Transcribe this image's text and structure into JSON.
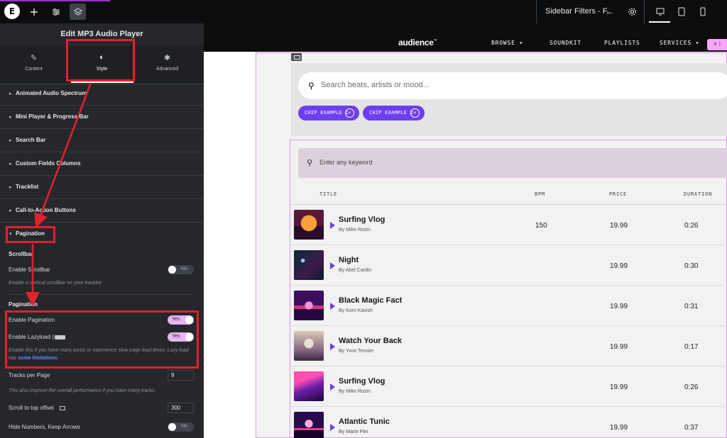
{
  "topbar": {
    "doc_title": "Sidebar Filters - F...",
    "icons": [
      "elementor-logo-icon",
      "plus-icon",
      "sliders-icon",
      "layers-icon",
      "settings-icon",
      "desktop-icon",
      "tablet-icon",
      "mobile-icon"
    ]
  },
  "panel": {
    "title": "Edit MP3 Audio Player",
    "tabs": [
      {
        "label": "Content",
        "icon": "pencil-icon"
      },
      {
        "label": "Style",
        "icon": "contrast-icon"
      },
      {
        "label": "Advanced",
        "icon": "gear-icon"
      }
    ],
    "sections": [
      {
        "label": "Animated Audio Spectrum"
      },
      {
        "label": "Mini Player & Progress Bar"
      },
      {
        "label": "Search Bar"
      },
      {
        "label": "Custom Fields Columns"
      },
      {
        "label": "Tracklist"
      },
      {
        "label": "Call-to-Action Buttons"
      }
    ],
    "open_section": "Pagination",
    "scrollbar": {
      "heading": "Scrollbar",
      "enable_label": "Enable Scrollbar",
      "enable_value": "No",
      "description": "Enable a vertical scrollbar on your tracklist"
    },
    "pagination": {
      "heading": "Pagination",
      "enable_label": "Enable Pagination",
      "enable_value": "Yes",
      "lazy_label": "Enable Lazyload (",
      "lazy_value": "Yes",
      "lazy_description": "Enable this if you have many posts or experience slow page load times. Lazy load has ",
      "lazy_link": "some limitations."
    },
    "tracks_per_page": {
      "label": "Tracks per Page",
      "value": "9",
      "description": "This also improve the overall performance if you have many tracks."
    },
    "scroll_offset": {
      "label": "Scroll to top offset",
      "value": "300"
    },
    "hide_numbers": {
      "label": "Hide Numbers, Keep Arrows",
      "value": "No"
    }
  },
  "site": {
    "logo": "audience",
    "logo_tm": "™",
    "nav": [
      "BROWSE",
      "SOUNDKIT",
      "PLAYLISTS",
      "SERVICES"
    ],
    "search_placeholder": "Search beats, artists or mood...",
    "chips": [
      "CHIP EXAMPLE 1",
      "CHIP EXAMPLE 2"
    ],
    "keyword_placeholder": "Enter any keyword",
    "columns": [
      "TITLE",
      "BPM",
      "PRICE",
      "DURATION"
    ],
    "tracks": [
      {
        "title": "Surfing Vlog",
        "artist": "By Mike Rozin",
        "bpm": "150",
        "price": "19.99",
        "duration": "0:26"
      },
      {
        "title": "Night",
        "artist": "By Abel Cardin",
        "bpm": "",
        "price": "19.99",
        "duration": "0:30"
      },
      {
        "title": "Black Magic Fact",
        "artist": "By Koro Kavish",
        "bpm": "",
        "price": "19.99",
        "duration": "0:31"
      },
      {
        "title": "Watch Your Back",
        "artist": "By Yvon Tessier",
        "bpm": "",
        "price": "19.99",
        "duration": "0:17"
      },
      {
        "title": "Surfing Vlog",
        "artist": "By Mike Rozin",
        "bpm": "",
        "price": "19.99",
        "duration": "0:26"
      },
      {
        "title": "Atlantic Tunic",
        "artist": "By Marie Pier",
        "bpm": "",
        "price": "19.99",
        "duration": "0:37"
      }
    ]
  },
  "colors": {
    "accent": "#6d3ef2",
    "annotation_red": "#e3202d",
    "toggle_on": "#e5b6ee"
  }
}
